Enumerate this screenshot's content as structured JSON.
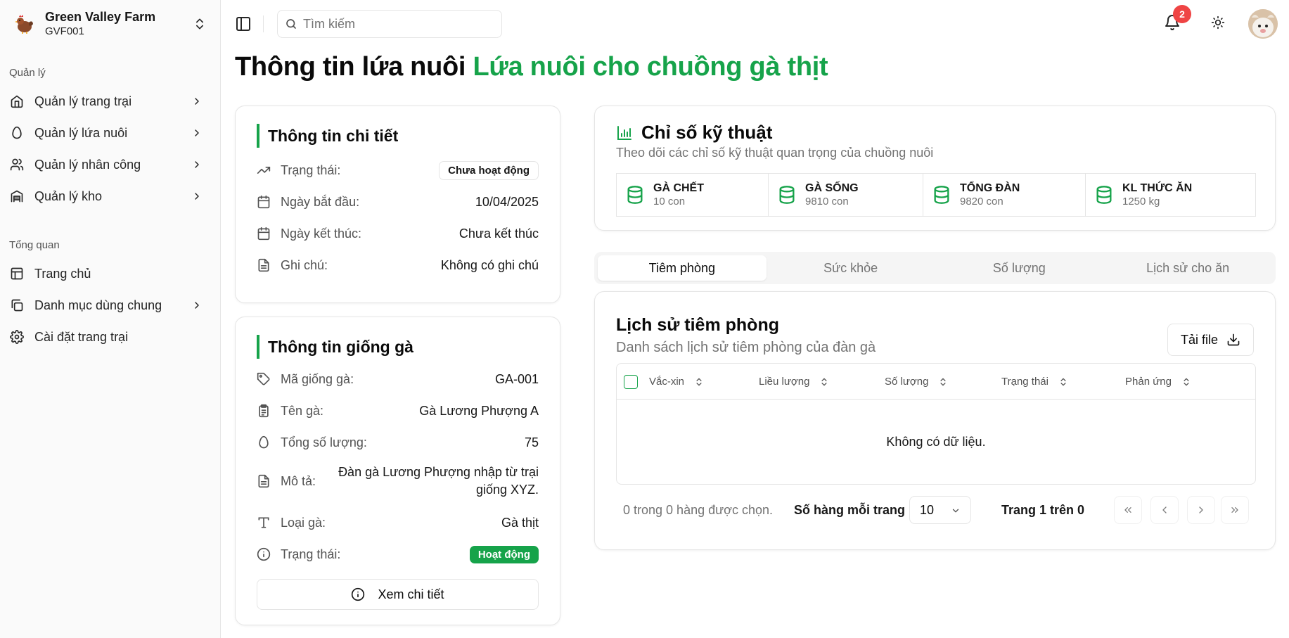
{
  "sidebar": {
    "farm_name": "Green Valley Farm",
    "farm_code": "GVF001",
    "group_manage": "Quản lý",
    "manage_items": [
      {
        "label": "Quản lý trang trại",
        "icon": "home-icon"
      },
      {
        "label": "Quản lý lứa nuôi",
        "icon": "egg-icon"
      },
      {
        "label": "Quản lý nhân công",
        "icon": "users-icon"
      },
      {
        "label": "Quản lý kho",
        "icon": "warehouse-icon"
      }
    ],
    "group_overview": "Tổng quan",
    "overview_items": [
      {
        "label": "Trang chủ",
        "icon": "layout-icon"
      },
      {
        "label": "Danh mục dùng chung",
        "icon": "copy-icon"
      },
      {
        "label": "Cài đặt trang trại",
        "icon": "gear-icon"
      }
    ]
  },
  "topbar": {
    "search_placeholder": "Tìm kiếm",
    "notification_count": "2"
  },
  "page": {
    "title": "Thông tin lứa nuôi",
    "subtitle": "Lứa nuôi cho chuồng gà thịt"
  },
  "detail": {
    "title": "Thông tin chi tiết",
    "status_label": "Trạng thái:",
    "status_value": "Chưa hoạt động",
    "start_label": "Ngày bắt đầu:",
    "start_value": "10/04/2025",
    "end_label": "Ngày kết thúc:",
    "end_value": "Chưa kết thúc",
    "note_label": "Ghi chú:",
    "note_value": "Không có ghi chú"
  },
  "breed": {
    "title": "Thông tin giống gà",
    "code_label": "Mã giống gà:",
    "code_value": "GA-001",
    "name_label": "Tên gà:",
    "name_value": "Gà Lương Phượng A",
    "total_label": "Tổng số lượng:",
    "total_value": "75",
    "desc_label": "Mô tả:",
    "desc_value": "Đàn gà Lương Phượng nhập từ trại giống XYZ.",
    "type_label": "Loại gà:",
    "type_value": "Gà thịt",
    "status_label": "Trạng thái:",
    "status_value": "Hoạt động",
    "detail_button": "Xem chi tiết"
  },
  "technical": {
    "title": "Chỉ số kỹ thuật",
    "description": "Theo dõi các chỉ số kỹ thuật quan trọng của chuồng nuôi",
    "stats": [
      {
        "label": "GÀ CHẾT",
        "value": "10 con"
      },
      {
        "label": "GÀ SỐNG",
        "value": "9810 con"
      },
      {
        "label": "TỔNG ĐÀN",
        "value": "9820 con"
      },
      {
        "label": "KL THỨC ĂN",
        "value": "1250 kg"
      }
    ]
  },
  "tabs": [
    "Tiêm phòng",
    "Sức khỏe",
    "Số lượng",
    "Lịch sử cho ăn"
  ],
  "active_tab": "Tiêm phòng",
  "vaccination": {
    "title": "Lịch sử tiêm phòng",
    "description": "Danh sách lịch sử tiêm phòng của đàn gà",
    "download_button": "Tải file",
    "columns": [
      "Vắc-xin",
      "Liều lượng",
      "Số lượng",
      "Trạng thái",
      "Phản ứng"
    ],
    "empty_text": "Không có dữ liệu.",
    "selected_text": "0 trong 0 hàng được chọn.",
    "rows_per_page_label": "Số hàng mỗi trang",
    "rows_per_page_value": "10",
    "page_text": "Trang 1 trên 0"
  },
  "colors": {
    "accent": "#16a34a",
    "badge": "#ef4444",
    "muted_text": "#737373",
    "border": "#e5e5e5"
  }
}
